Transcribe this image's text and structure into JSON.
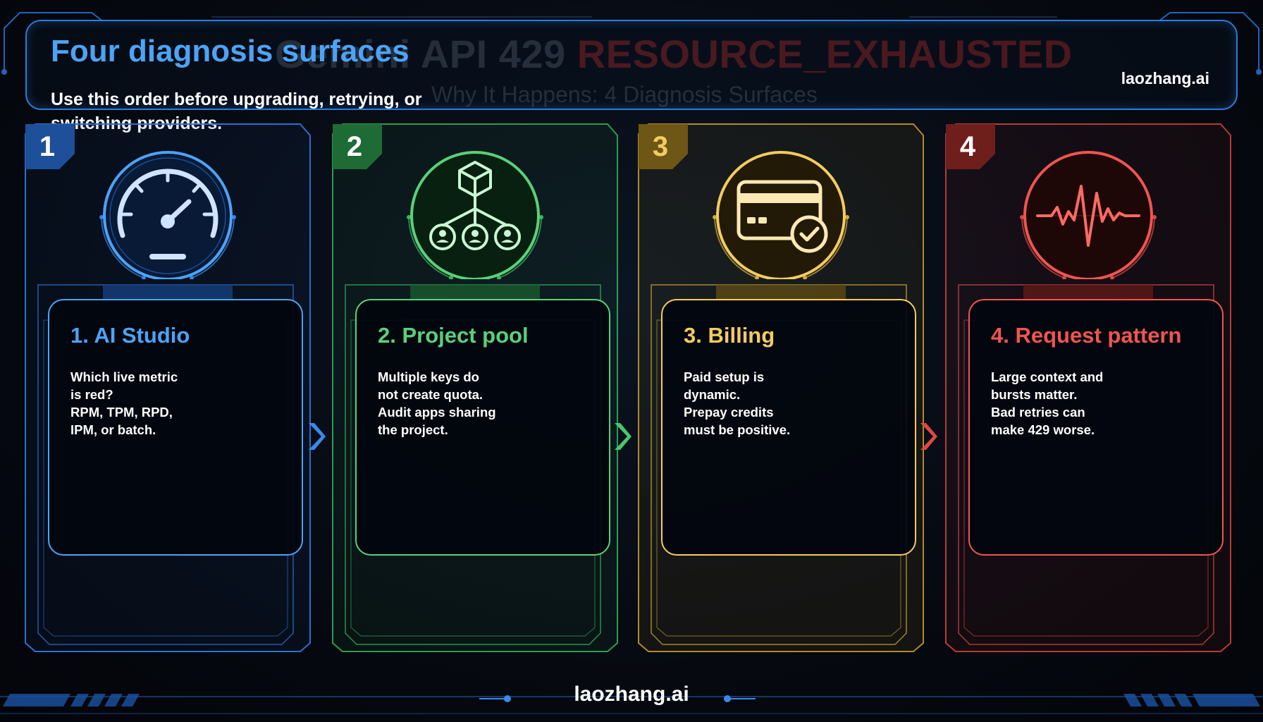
{
  "header": {
    "title": "Four diagnosis surfaces",
    "subtitle": "Use this order before upgrading, retrying, or switching providers.",
    "brand": "laozhang.ai",
    "ghost_title_prefix": "Gemini API 429",
    "ghost_title_suffix": "RESOURCE_EXHAUSTED",
    "ghost_subtitle": "Why It Happens: 4 Diagnosis Surfaces"
  },
  "panels": [
    {
      "number": "1",
      "title": "1. AI Studio",
      "body_lines": [
        "Which live metric",
        "is red?",
        "RPM, TPM, RPD,",
        "IPM, or batch."
      ],
      "icon": "speedometer-icon",
      "color": "#4da3f5"
    },
    {
      "number": "2",
      "title": "2. Project pool",
      "body_lines": [
        "Multiple keys do",
        "not create quota.",
        "Audit apps sharing",
        "the project."
      ],
      "icon": "project-network-icon",
      "color": "#5ad17a"
    },
    {
      "number": "3",
      "title": "3. Billing",
      "body_lines": [
        "Paid setup is",
        "dynamic.",
        "Prepay credits",
        "must be positive."
      ],
      "icon": "credit-card-check-icon",
      "color": "#f4cc5e"
    },
    {
      "number": "4",
      "title": "4. Request pattern",
      "body_lines": [
        "Large context and",
        "bursts matter.",
        "Bad retries can",
        "make 429 worse."
      ],
      "icon": "pulse-wave-icon",
      "color": "#f0554f"
    }
  ],
  "footer": {
    "brand": "laozhang.ai"
  }
}
